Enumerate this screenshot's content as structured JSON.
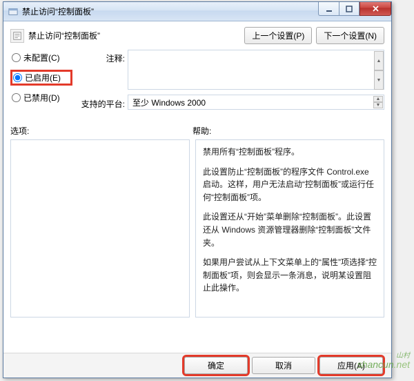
{
  "window": {
    "title": "禁止访问“控制面板”"
  },
  "header": {
    "title": "禁止访问“控制面板”",
    "prev_btn": "上一个设置(P)",
    "next_btn": "下一个设置(N)"
  },
  "radios": {
    "not_configured": "未配置(C)",
    "enabled": "已启用(E)",
    "disabled": "已禁用(D)"
  },
  "labels": {
    "comment": "注释:",
    "platform": "支持的平台:",
    "options": "选项:",
    "help": "帮助:"
  },
  "platform_value": "至少 Windows 2000",
  "help_text": {
    "p1": "禁用所有“控制面板”程序。",
    "p2": "此设置防止“控制面板”的程序文件 Control.exe 启动。这样，用户无法启动“控制面板”或运行任何“控制面板”项。",
    "p3": "此设置还从“开始”菜单删除“控制面板”。此设置还从 Windows 资源管理器删除“控制面板”文件夹。",
    "p4": "如果用户尝试从上下文菜单上的“属性”项选择“控制面板”项，则会显示一条消息，说明某设置阻止此操作。"
  },
  "footer": {
    "ok": "确定",
    "cancel": "取消",
    "apply": "应用(A)"
  },
  "watermark": {
    "main": "shancun",
    "suffix": ".net",
    "cn": "山村"
  }
}
